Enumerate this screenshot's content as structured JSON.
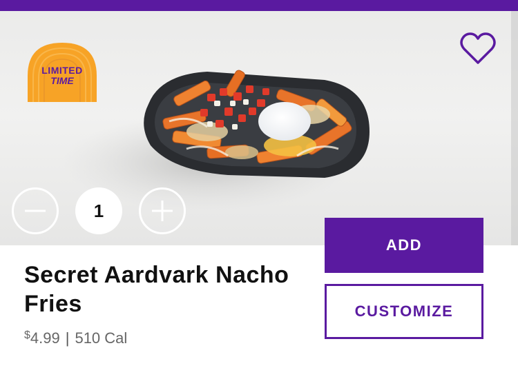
{
  "badge": {
    "line1": "LIMITED",
    "line2": "TIME"
  },
  "quantity": {
    "value": "1",
    "decrease_icon": "minus-icon",
    "increase_icon": "plus-icon"
  },
  "favorite": {
    "icon": "heart-outline-icon"
  },
  "product": {
    "name": "Secret Aardvark Nacho Fries",
    "currency": "$",
    "price": "4.99",
    "separator": "|",
    "calories": "510 Cal"
  },
  "actions": {
    "add_label": "ADD",
    "customize_label": "CUSTOMIZE"
  },
  "colors": {
    "brand_purple": "#5a1aa0",
    "badge_orange": "#f7a326",
    "text_dark": "#111111",
    "text_gray": "#666666"
  }
}
